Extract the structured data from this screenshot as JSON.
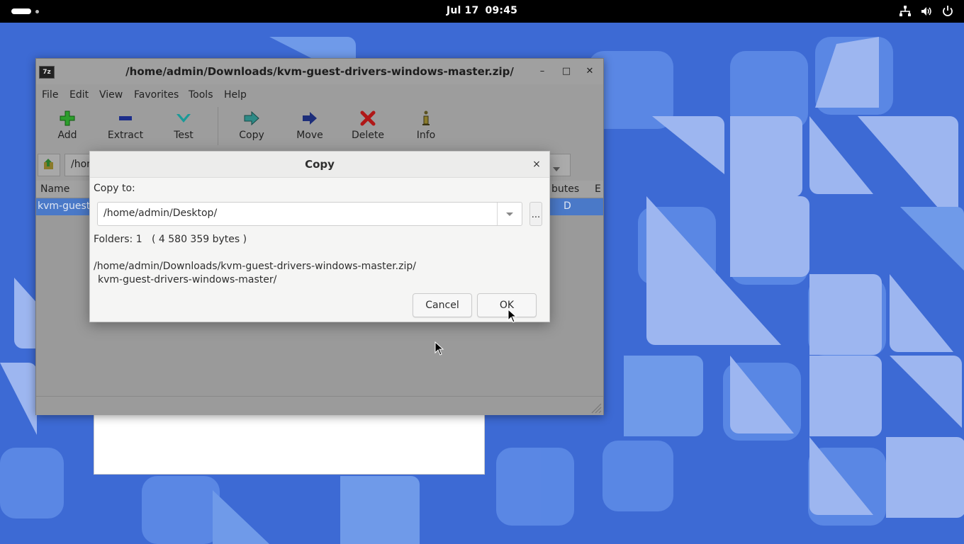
{
  "topbar": {
    "date": "Jul 17",
    "time": "09:45",
    "tray_icons": [
      "network-icon",
      "volume-icon",
      "power-icon"
    ]
  },
  "main_window": {
    "title": "/home/admin/Downloads/kvm-guest-drivers-windows-master.zip/",
    "app_icon_text": "7z",
    "minimize": "–",
    "maximize": "□",
    "close": "✕",
    "menu": [
      "File",
      "Edit",
      "View",
      "Favorites",
      "Tools",
      "Help"
    ],
    "toolbar": [
      {
        "label": "Add",
        "icon": "add-icon"
      },
      {
        "label": "Extract",
        "icon": "extract-icon"
      },
      {
        "label": "Test",
        "icon": "test-icon"
      },
      {
        "label": "Copy",
        "icon": "copy-icon"
      },
      {
        "label": "Move",
        "icon": "move-icon"
      },
      {
        "label": "Delete",
        "icon": "delete-icon"
      },
      {
        "label": "Info",
        "icon": "info-icon"
      }
    ],
    "path": "/hom",
    "columns": {
      "name": "Name",
      "attributes": "butes",
      "extra": "E"
    },
    "row": {
      "name": "kvm-guest-",
      "attributes": "D"
    }
  },
  "copy_dialog": {
    "title": "Copy",
    "close": "×",
    "copy_to_label": "Copy to:",
    "destination": "/home/admin/Desktop/",
    "browse_label": "...",
    "info": "Folders: 1   ( 4 580 359 bytes )",
    "source_path": "/home/admin/Downloads/kvm-guest-drivers-windows-master.zip/",
    "source_item": "kvm-guest-drivers-windows-master/",
    "cancel_label": "Cancel",
    "ok_label": "OK"
  },
  "colors": {
    "wallpaper": "#3f6fd6",
    "selection": "#4a79c8",
    "dialog_bg": "#f5f5f4"
  }
}
